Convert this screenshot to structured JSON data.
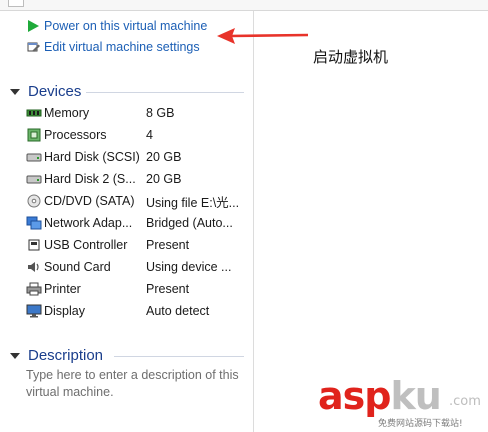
{
  "actions": {
    "power_on": "Power on this virtual machine",
    "edit_settings": "Edit virtual machine settings"
  },
  "annotation": "启动虚拟机",
  "devices": {
    "title": "Devices",
    "items": [
      {
        "name": "Memory",
        "value": "8 GB",
        "icon": "memory-icon"
      },
      {
        "name": "Processors",
        "value": "4",
        "icon": "processor-icon"
      },
      {
        "name": "Hard Disk (SCSI)",
        "value": "20 GB",
        "icon": "hard-disk-icon"
      },
      {
        "name": "Hard Disk 2 (S...",
        "value": "20 GB",
        "icon": "hard-disk-icon"
      },
      {
        "name": "CD/DVD (SATA)",
        "value": "Using file E:\\光...",
        "icon": "cd-dvd-icon"
      },
      {
        "name": "Network Adap...",
        "value": "Bridged (Auto...",
        "icon": "network-adapter-icon"
      },
      {
        "name": "USB Controller",
        "value": "Present",
        "icon": "usb-icon"
      },
      {
        "name": "Sound Card",
        "value": "Using device ...",
        "icon": "sound-card-icon"
      },
      {
        "name": "Printer",
        "value": "Present",
        "icon": "printer-icon"
      },
      {
        "name": "Display",
        "value": "Auto detect",
        "icon": "display-icon"
      }
    ]
  },
  "description": {
    "title": "Description",
    "placeholder": "Type here to enter a description of this virtual machine."
  },
  "watermark": {
    "main_red": "asp",
    "main_gray": "ku",
    "dot": ".com",
    "sub": "免费网站源码下载站!"
  },
  "colors": {
    "link": "#1c5fb5",
    "section": "#1a3e8c",
    "arrow": "#e8332a",
    "play": "#1faa3a"
  }
}
